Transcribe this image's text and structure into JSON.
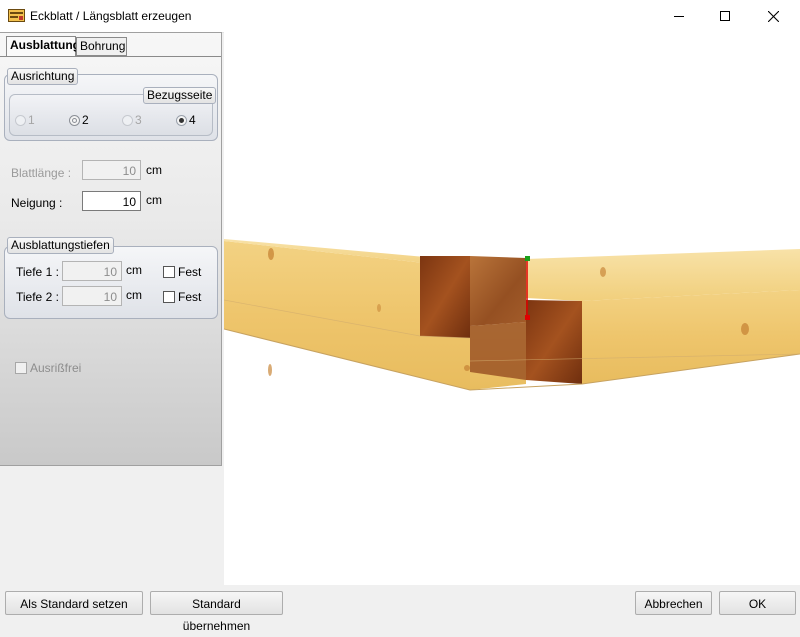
{
  "window": {
    "title": "Eckblatt / Längsblatt erzeugen",
    "icon": "app-icon",
    "controls": [
      "minimize-icon",
      "maximize-icon",
      "close-icon"
    ]
  },
  "tabs": [
    {
      "label": "Ausblattung",
      "active": true
    },
    {
      "label": "Bohrung",
      "active": false
    }
  ],
  "ausrichtung": {
    "title": "Ausrichtung",
    "bezugsseite_label": "Bezugsseite",
    "options": [
      {
        "label": "1",
        "state": "disabled"
      },
      {
        "label": "2",
        "state": "indeterminate"
      },
      {
        "label": "3",
        "state": "disabled"
      },
      {
        "label": "4",
        "state": "selected"
      }
    ]
  },
  "blattlaenge": {
    "label": "Blattlänge :",
    "value": "10",
    "unit": "cm",
    "enabled": false
  },
  "neigung": {
    "label": "Neigung :",
    "value": "10",
    "unit": "cm",
    "enabled": true
  },
  "tiefen": {
    "title": "Ausblattungstiefen",
    "rows": [
      {
        "label": "Tiefe 1 :",
        "value": "10",
        "unit": "cm",
        "fest_label": "Fest",
        "fest_checked": false
      },
      {
        "label": "Tiefe 2 :",
        "value": "10",
        "unit": "cm",
        "fest_label": "Fest",
        "fest_checked": false
      }
    ]
  },
  "ausrissfrei": {
    "label": "Ausrißfrei",
    "checked": false,
    "enabled": false
  },
  "footer": {
    "set_default": "Als Standard setzen",
    "apply_default": "Standard übernehmen",
    "cancel": "Abbrechen",
    "ok": "OK"
  },
  "colors": {
    "wood_light": "#f4d27e",
    "wood_dark": "#8a3f16",
    "edge_marker_green": "#1aa01a",
    "edge_marker_red": "#e00000"
  }
}
